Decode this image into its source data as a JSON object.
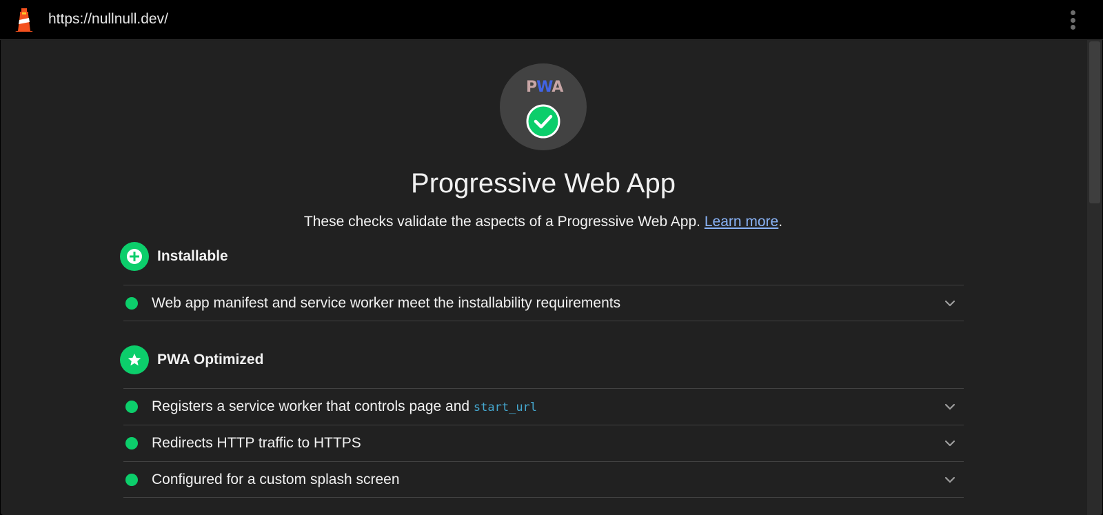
{
  "topbar": {
    "url": "https://nullnull.dev/",
    "logo_icon": "lighthouse-icon",
    "menu_icon": "kebab-menu-icon"
  },
  "gauge": {
    "badge_p": "P",
    "badge_w": "W",
    "badge_a": "A",
    "status_icon": "check-circle-icon",
    "colors": {
      "pass": "#0cce6b",
      "p_letter": "#c8a6a6",
      "w_letter": "#4164e6"
    }
  },
  "category": {
    "title": "Progressive Web App",
    "description": "These checks validate the aspects of a Progressive Web App. ",
    "learn_more": "Learn more",
    "description_end": "."
  },
  "groups": [
    {
      "title": "Installable",
      "icon": "plus-circle-icon",
      "audits": [
        {
          "title": "Web app manifest and service worker meet the installability requirements",
          "code": ""
        }
      ]
    },
    {
      "title": "PWA Optimized",
      "icon": "star-icon",
      "audits": [
        {
          "title": "Registers a service worker that controls page and ",
          "code": "start_url"
        },
        {
          "title": "Redirects HTTP traffic to HTTPS",
          "code": ""
        },
        {
          "title": "Configured for a custom splash screen",
          "code": ""
        }
      ]
    }
  ]
}
